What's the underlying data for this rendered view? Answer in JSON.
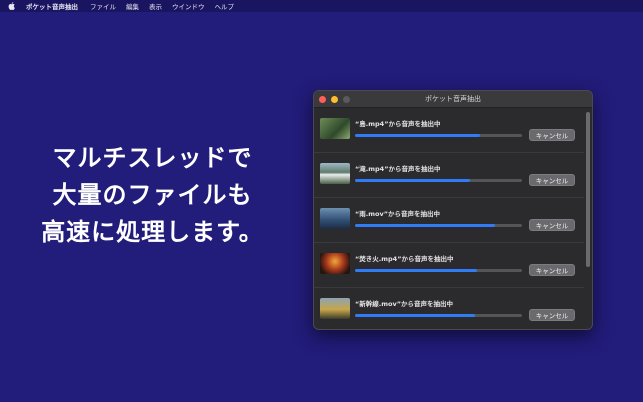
{
  "menubar": {
    "apple_icon": "apple-icon",
    "app_name": "ポケット音声抽出",
    "items": [
      "ファイル",
      "編集",
      "表示",
      "ウインドウ",
      "ヘルプ"
    ]
  },
  "headline": {
    "line1": "マルチスレッドで",
    "line2": "大量のファイルも",
    "line3": "高速に処理します。"
  },
  "window": {
    "title": "ポケット音声抽出",
    "jobs": [
      {
        "label": "“島.mp4”から音声を抽出中",
        "progress": 0.75,
        "cancel": "キャンセル"
      },
      {
        "label": "“滝.mp4”から音声を抽出中",
        "progress": 0.69,
        "cancel": "キャンセル"
      },
      {
        "label": "“雨.mov”から音声を抽出中",
        "progress": 0.84,
        "cancel": "キャンセル"
      },
      {
        "label": "“焚き火.mp4”から音声を抽出中",
        "progress": 0.73,
        "cancel": "キャンセル"
      },
      {
        "label": "“新幹線.mov”から音声を抽出中",
        "progress": 0.72,
        "cancel": "キャンセル"
      }
    ]
  },
  "colors": {
    "background": "#221c7a",
    "accent": "#2f7cf6"
  }
}
